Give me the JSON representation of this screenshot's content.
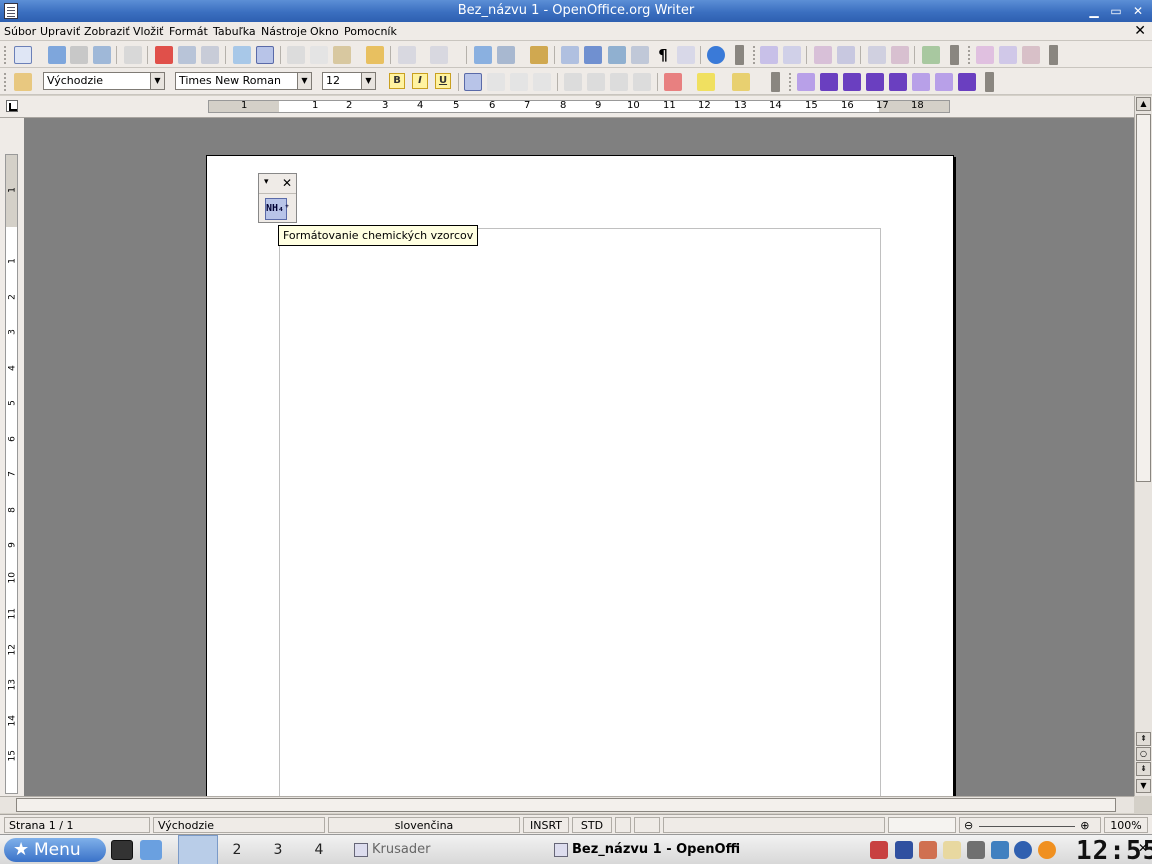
{
  "window": {
    "title": "Bez_názvu 1 - OpenOffice.org Writer",
    "minimize_glyph": "▁",
    "maximize_glyph": "▭",
    "close_glyph": "✕",
    "doc_close_glyph": "✕"
  },
  "menubar": {
    "items": [
      {
        "label": "Súbor",
        "name": "menu-file"
      },
      {
        "label": "Upraviť",
        "name": "menu-edit"
      },
      {
        "label": "Zobraziť",
        "name": "menu-view"
      },
      {
        "label": "Vložiť",
        "name": "menu-insert"
      },
      {
        "label": "Formát",
        "name": "menu-format"
      },
      {
        "label": "Tabuľka",
        "name": "menu-table"
      },
      {
        "label": "Nástroje",
        "name": "menu-tools"
      },
      {
        "label": "Okno",
        "name": "menu-window"
      },
      {
        "label": "Pomocník",
        "name": "menu-help"
      }
    ]
  },
  "format_bar": {
    "paragraph_style": "Východzie",
    "font_name": "Times New Roman",
    "font_size": "12",
    "bold_label": "B",
    "italic_label": "I",
    "underline_label": "U",
    "combo_arrow": "▼"
  },
  "ruler": {
    "h_ticks": [
      "1",
      "1",
      "2",
      "3",
      "4",
      "5",
      "6",
      "7",
      "8",
      "9",
      "10",
      "11",
      "12",
      "13",
      "14",
      "15",
      "16",
      "17",
      "18"
    ],
    "v_ticks": [
      "1",
      "1",
      "2",
      "3",
      "4",
      "5",
      "6",
      "7",
      "8",
      "9",
      "10",
      "11",
      "12",
      "13",
      "14",
      "15"
    ]
  },
  "floating_toolbar": {
    "menu_glyph": "▾",
    "close_glyph": "✕",
    "button_label": "NH₄⁺",
    "tooltip": "Formátovanie chemických vzorcov"
  },
  "scrollbar": {
    "up": "▲",
    "down": "▼",
    "page_up": "⇞",
    "page_down": "⇟",
    "navigator": "○"
  },
  "statusbar": {
    "page": "Strana 1 / 1",
    "style": "Východzie",
    "language": "slovenčina",
    "insert_mode": "INSRT",
    "selection_mode": "STD",
    "zoom": "100%",
    "zoom_minus": "⊖",
    "zoom_plus": "⊕"
  },
  "taskbar": {
    "menu_label": "Menu",
    "star_glyph": "★",
    "workspaces": [
      "2",
      "3",
      "4"
    ],
    "tasks": [
      {
        "label": "Krusader"
      },
      {
        "label": "Bez_názvu 1 - OpenOffi"
      }
    ],
    "clock": "12:55",
    "close_glyph": "✕"
  },
  "colors": {
    "title_bar": "#3b6fc0",
    "workspace": "#808080",
    "tooltip_bg": "#ffffe1",
    "accent_purple": "#6a3fc0"
  }
}
